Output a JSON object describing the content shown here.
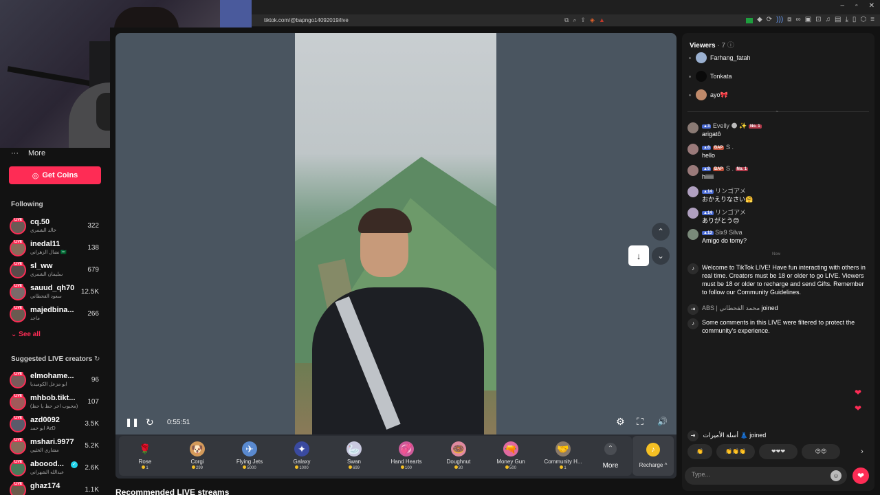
{
  "browser": {
    "url": "tiktok.com/@bapngo14092019/live",
    "window_controls": [
      "–",
      "▫",
      "✕"
    ]
  },
  "sidebar": {
    "more_label": "More",
    "get_coins_label": "Get Coins",
    "following_title": "Following",
    "following": [
      {
        "name": "cq.50",
        "sub": "خالد الشمري",
        "count": "322"
      },
      {
        "name": "inedal11",
        "sub": "نضال الزهراني 🇸🇦",
        "count": "138"
      },
      {
        "name": "sl_ww",
        "sub": "سليمان الشمري",
        "count": "679"
      },
      {
        "name": "sauud_qh70",
        "sub": "سعود القحطاني",
        "count": "12.5K"
      },
      {
        "name": "majedbina...",
        "sub": "ماجد",
        "count": "266"
      }
    ],
    "see_all_label": "See all",
    "suggested_title": "Suggested LIVE creators",
    "suggested": [
      {
        "name": "elmohame...",
        "sub": "ابو مزعل الكوميديا",
        "count": "96"
      },
      {
        "name": "mhbob.tikt...",
        "sub": "(محبوب اخر حظ يا حظ)",
        "count": "107"
      },
      {
        "name": "azd0092",
        "sub": "ابو حمد AzD",
        "count": "3.5K"
      },
      {
        "name": "mshari.9977",
        "sub": "مشاري الخثيي",
        "count": "5.2K"
      },
      {
        "name": "aboood...",
        "sub": "عبدالله الشهراني",
        "count": "2.6K"
      },
      {
        "name": "ghaz174",
        "sub": "",
        "count": "1.1K"
      }
    ]
  },
  "player": {
    "time": "0:55:51"
  },
  "gifts": [
    {
      "name": "Rose",
      "price": "1",
      "icon": "🌹",
      "color": "#8a2a2a"
    },
    {
      "name": "Corgi",
      "price": "299",
      "icon": "🐶",
      "color": "#d39a5a"
    },
    {
      "name": "Flying Jets",
      "price": "5000",
      "icon": "✈",
      "color": "#5a8ad0"
    },
    {
      "name": "Galaxy",
      "price": "1000",
      "icon": "✦",
      "color": "#3a4aa0"
    },
    {
      "name": "Swan",
      "price": "699",
      "icon": "🦢",
      "color": "#c9c9e0"
    },
    {
      "name": "Hand Hearts",
      "price": "100",
      "icon": "💞",
      "color": "#d05a9a"
    },
    {
      "name": "Doughnut",
      "price": "30",
      "icon": "🍩",
      "color": "#e08aa0"
    },
    {
      "name": "Money Gun",
      "price": "500",
      "icon": "🔫",
      "color": "#e06aa0"
    },
    {
      "name": "Community H...",
      "price": "1",
      "icon": "🤝",
      "color": "#8a7a6a"
    }
  ],
  "gift_more_label": "More",
  "recharge_label": "Recharge ^",
  "recommended_title": "Recommended LIVE streams",
  "panel": {
    "viewers_label": "Viewers",
    "viewers_count": "· 7",
    "viewers": [
      {
        "name": "Farhang_fatah",
        "color": "#9ab0d0"
      },
      {
        "name": "Tonkata",
        "color": "#0a0a0a"
      },
      {
        "name": "ayo🎀",
        "color": "#c08a6a"
      }
    ],
    "messages": [
      {
        "level": "3",
        "user": "Evelly 🌑 ✨",
        "badge": "No. 1",
        "text": "arigatô"
      },
      {
        "level": "8",
        "user": "S .",
        "badge": "BAP",
        "text": "hello"
      },
      {
        "level": "8",
        "user": "S .",
        "badge": "BAP",
        "badge2": "No. 1",
        "text": "hiiiiii"
      },
      {
        "level": "14",
        "user": "リンゴアメ",
        "badge": "",
        "text": "おかえりなさい🤗"
      },
      {
        "level": "14",
        "user": "リンゴアメ",
        "badge": "",
        "text": "ありがとう😊"
      },
      {
        "level": "13",
        "user": "Six9 Silva",
        "badge": "",
        "text": "Amigo do tomy?"
      }
    ],
    "now_label": "Now",
    "welcome_text": "Welcome to TikTok LIVE! Have fun interacting with others in real time. Creators must be 18 or older to go LIVE. Viewers must be 18 or older to recharge and send Gifts. Remember to follow our Community Guidelines.",
    "joined_user": "ABS | محمد القحطاني",
    "joined_label": "joined",
    "filter_text": "Some comments in this LIVE were filtered to protect the community's experience.",
    "bottom_joined_user": "أسلة الأميرات 👗",
    "quick_replies": [
      "👏",
      "👏👏👏",
      "❤❤❤",
      "😍😍"
    ],
    "input_placeholder": "Type..."
  }
}
